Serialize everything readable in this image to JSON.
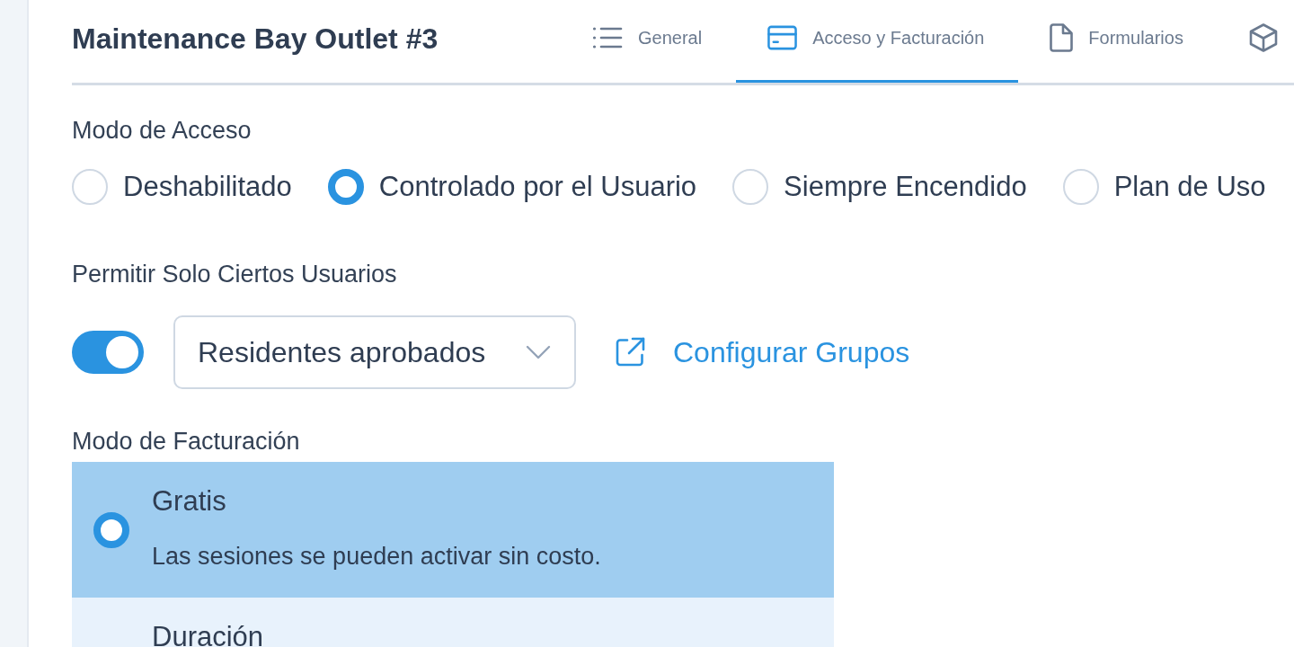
{
  "header": {
    "title": "Maintenance Bay Outlet #3"
  },
  "tabs": [
    {
      "label": "General",
      "selected": false
    },
    {
      "label": "Acceso y Facturación",
      "selected": true
    },
    {
      "label": "Formularios",
      "selected": false
    },
    {
      "selected": false
    }
  ],
  "access_mode": {
    "label": "Modo de Acceso",
    "options": [
      {
        "label": "Deshabilitado",
        "selected": false
      },
      {
        "label": "Controlado por el Usuario",
        "selected": true
      },
      {
        "label": "Siempre Encendido",
        "selected": false
      },
      {
        "label": "Plan de Uso",
        "selected": false
      }
    ]
  },
  "restrict_users": {
    "label": "Permitir Solo Ciertos Usuarios",
    "on": true,
    "group_select": {
      "value": "Residentes aprobados"
    },
    "link": "Configurar Grupos"
  },
  "billing_mode": {
    "label": "Modo de Facturación",
    "options": [
      {
        "title": "Gratis",
        "description": "Las sesiones se pueden activar sin costo.",
        "selected": true
      },
      {
        "title": "Duración",
        "selected": false
      }
    ]
  }
}
